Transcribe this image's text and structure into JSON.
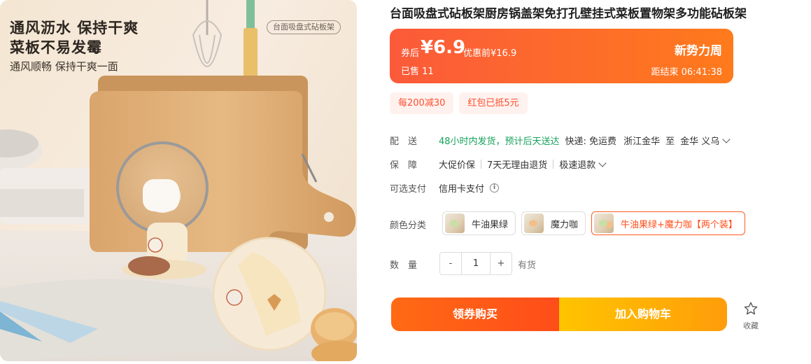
{
  "image": {
    "headline_1": "通风沥水 保持干爽",
    "headline_2": "菜板不易发霉",
    "subline": "通风顺畅 保持干爽一面",
    "tag": "台面吸盘式砧板架"
  },
  "product": {
    "title": "台面吸盘式砧板架厨房锅盖架免打孔壁挂式菜板置物架多功能砧板架"
  },
  "price_banner": {
    "coupon_label": "券后",
    "price": "¥6.9",
    "original_price": "优惠前¥16.9",
    "sold": "已售 11",
    "promo": "新势力周",
    "countdown": "距结束 06:41:38"
  },
  "coupons": [
    "每200减30",
    "红包已抵5元"
  ],
  "delivery": {
    "label": "配送",
    "promise": "48小时内发货，预计后天送达",
    "express": "快递: 免运费",
    "from": "浙江金华",
    "to_word": "至",
    "to": "金华 义乌"
  },
  "guarantee": {
    "label": "保障",
    "items": [
      "大促价保",
      "7天无理由退货",
      "极速退款"
    ]
  },
  "payment": {
    "label": "可选支付",
    "method": "信用卡支付"
  },
  "colors": {
    "label": "颜色分类",
    "options": [
      "牛油果绿",
      "魔力咖",
      "牛油果绿+魔力咖【两个装】"
    ],
    "selected": "牛油果绿+魔力咖【两个装】"
  },
  "quantity": {
    "label": "数量",
    "minus": "-",
    "value": "1",
    "plus": "+",
    "stock": "有货"
  },
  "actions": {
    "buy": "领券购买",
    "cart": "加入购物车",
    "favorite": "收藏"
  },
  "colors_theme": {
    "accent_orange": "#ff5a1f",
    "banner_start": "#fb5a3a",
    "cart_yellow": "#ffc400",
    "delivery_green": "#15a25a"
  }
}
